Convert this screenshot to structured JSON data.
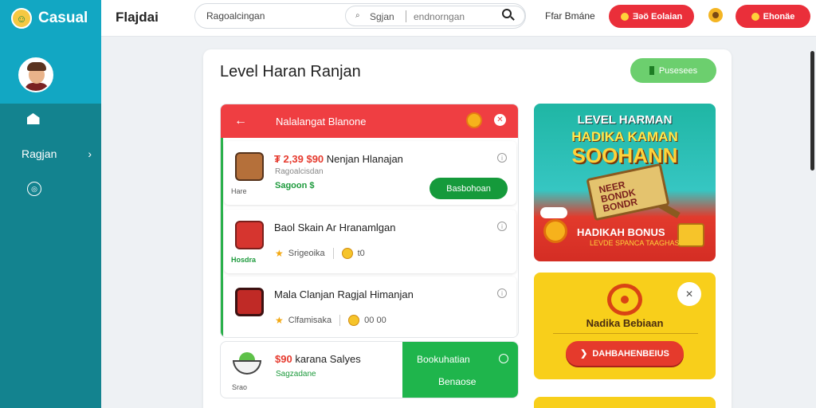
{
  "sidebar": {
    "logo_text": "Casual",
    "item_label": "Ragjan",
    "chevron": "›"
  },
  "topbar": {
    "brand": "Flajdai",
    "search_primary": "Ragoalcingan",
    "search_inner_left": "Sgjan",
    "search_inner_right": "endnorngan",
    "link": "Ffar Bmáne",
    "btn1": "Ǝǝӧ Eolaian",
    "btn2": "Ehonäe"
  },
  "main": {
    "title": "Level Haran Ranjan",
    "top_button": "Pusesees"
  },
  "offers": {
    "header": "Nalalangat Blanone",
    "rows": [
      {
        "amount": "₮ 2,39 $90",
        "title": "Nenjan Hlanajan",
        "sub": "Ragoalcisdan",
        "meta": "Sagoon $",
        "caption": "Hare",
        "button": "Basbohoan"
      },
      {
        "amount": "",
        "title": "Baol Skain Ar Hranamlgan",
        "sub": "",
        "meta1": "Srigeoika",
        "meta2": "t0",
        "caption": "Hosdra"
      },
      {
        "amount": "",
        "title": "Mala Clanjan Ragjal Himanjan",
        "sub": "",
        "meta1": "Clfamisaka",
        "meta2": "00 00",
        "caption": ""
      }
    ]
  },
  "bottom_offer": {
    "amount": "$90",
    "title": "karana Salyes",
    "sub": "Sagzadane",
    "caption": "Srao",
    "green_label1": "Bookuhatian",
    "green_label2": "Benaose"
  },
  "promo": {
    "line1": "LEVEL HARMAN",
    "line2": "HADIKA KAMAN",
    "line3": "SOOHANN",
    "sign_text": "NEER BONDK BONDR",
    "bonus": "HADIKAH BONUS",
    "sub": "LEVDE SPANCA TAAGHAS"
  },
  "reward_card": {
    "title": "Nadika Bebiaan",
    "button": "DAHBAHENBEIUS"
  },
  "colors": {
    "sidebar": "#13838f",
    "accent_red": "#ea2f3a",
    "accent_green": "#1fb54c",
    "yellow": "#f8cf1b"
  }
}
